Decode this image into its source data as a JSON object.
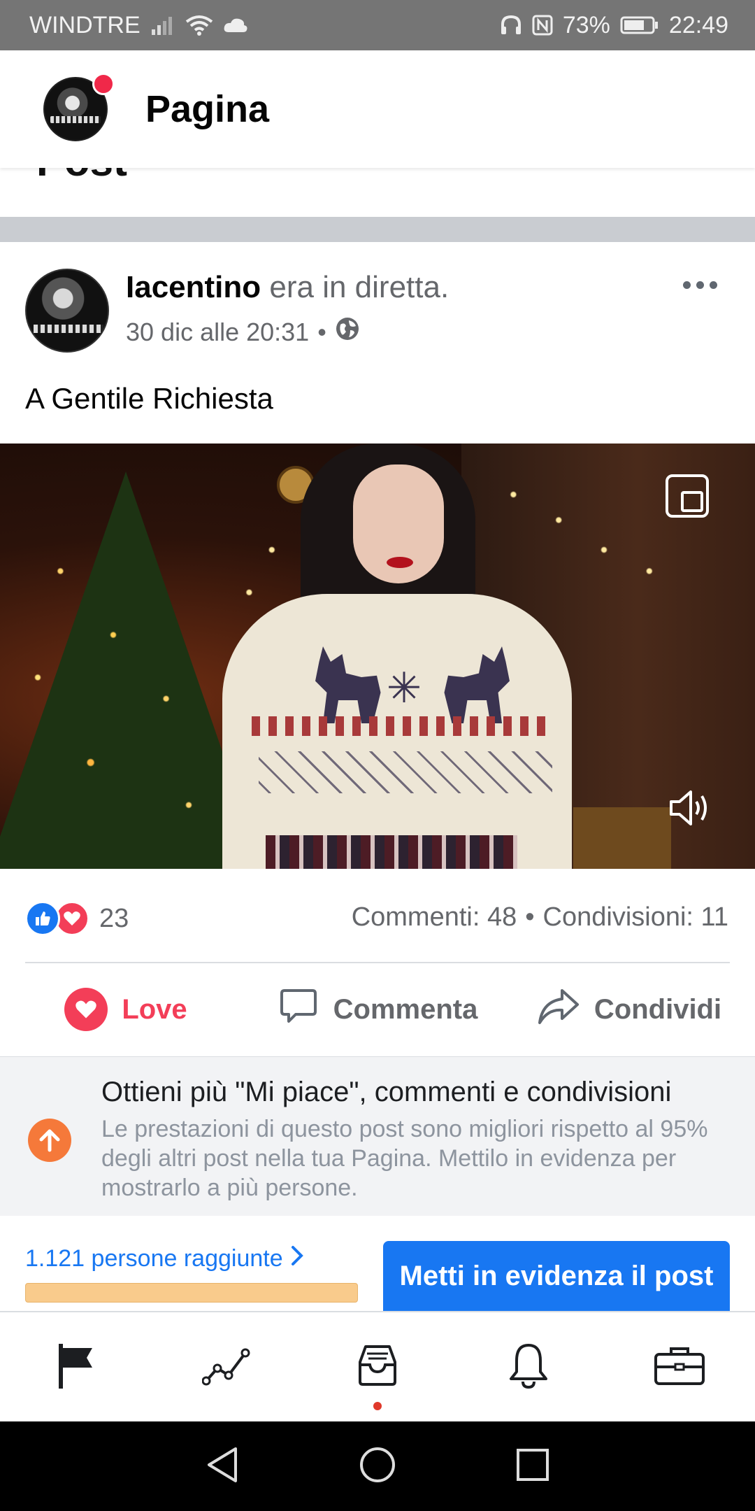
{
  "status_bar": {
    "carrier": "WINDTRE",
    "battery": "73%",
    "time": "22:49"
  },
  "header": {
    "title": "Pagina",
    "partial_label": "Post"
  },
  "post": {
    "author": "Iacentino",
    "action": "era in diretta.",
    "timestamp": "30 dic alle 20:31",
    "separator": "•",
    "text": "A Gentile Richiesta",
    "reactions_count": "23",
    "comments": "Commenti: 48",
    "shares": "Condivisioni: 11"
  },
  "actions": {
    "love": "Love",
    "comment": "Commenta",
    "share": "Condividi"
  },
  "boost": {
    "title": "Ottieni più \"Mi piace\", commenti e condivisioni",
    "description": "Le prestazioni di questo post sono migliori rispetto al 95% degli altri post nella tua Pagina. Mettilo in evidenza per mostrarlo a più persone.",
    "reach_label": "1.121 persone raggiunte",
    "reach_progress": 0.65,
    "button_label": "Metti in evidenza il post"
  },
  "bottom_nav": {
    "items": [
      "flag-icon",
      "insights-icon",
      "inbox-icon",
      "bell-icon",
      "briefcase-icon"
    ],
    "active_dot_on": "inbox-icon"
  },
  "colors": {
    "brand_blue": "#1877f2",
    "love_red": "#f33e58",
    "boost_orange": "#f5793a"
  }
}
